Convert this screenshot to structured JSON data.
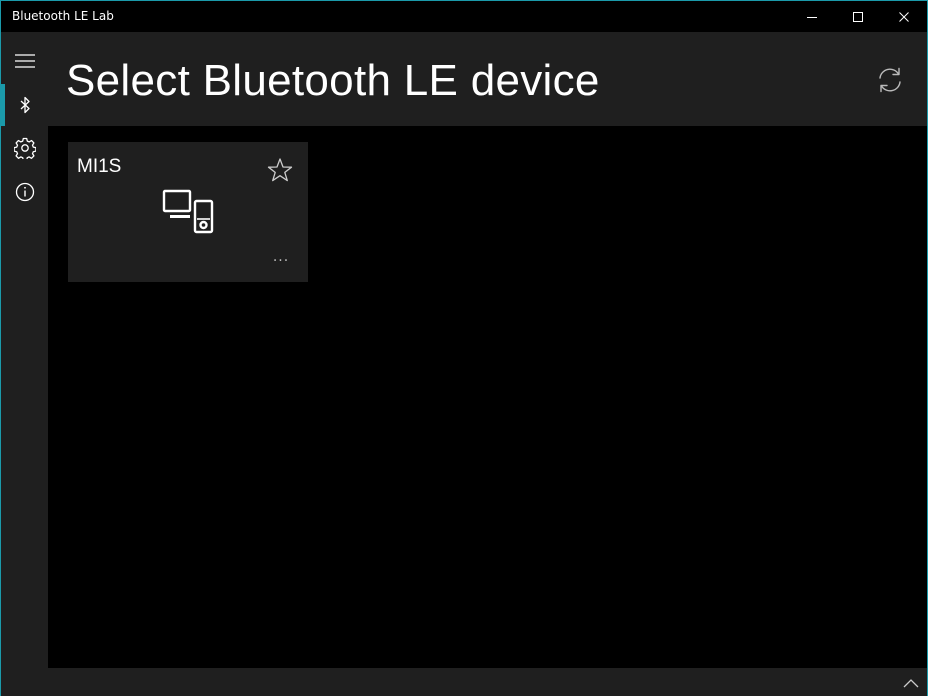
{
  "window": {
    "title": "Bluetooth LE Lab"
  },
  "titlebar_buttons": {
    "minimize_icon": "minimize-icon",
    "maximize_icon": "maximize-icon",
    "close_icon": "close-icon"
  },
  "sidebar": {
    "items": [
      {
        "icon": "hamburger-icon",
        "active": false
      },
      {
        "icon": "bluetooth-icon",
        "active": true
      },
      {
        "icon": "gear-icon",
        "active": false
      },
      {
        "icon": "info-icon",
        "active": false
      }
    ]
  },
  "header": {
    "title": "Select Bluetooth LE device",
    "refresh_icon": "refresh-icon"
  },
  "devices": [
    {
      "name": "MI1S",
      "icon": "devices-icon",
      "favorite_icon": "star-outline-icon",
      "more_label": "..."
    }
  ],
  "bottombar": {
    "expand_icon": "chevron-up-icon"
  },
  "colors": {
    "accent": "#1b9aaa",
    "panel": "#1f1f1f",
    "background": "#000000",
    "text": "#ffffff"
  }
}
